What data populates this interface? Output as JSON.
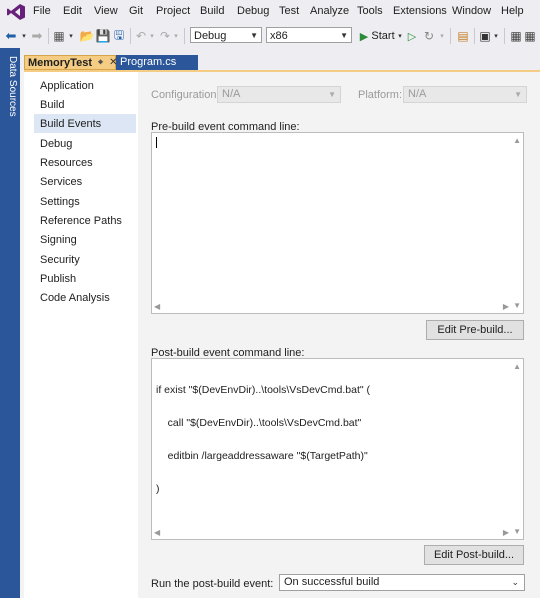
{
  "menu": {
    "items": [
      "File",
      "Edit",
      "View",
      "Git",
      "Project",
      "Build",
      "Debug",
      "Test",
      "Analyze",
      "Tools",
      "Extensions",
      "Window",
      "Help"
    ]
  },
  "toolbar": {
    "configuration": "Debug",
    "platform": "x86",
    "start_label": "Start"
  },
  "side_panel": {
    "label": "Data Sources"
  },
  "tabs": [
    {
      "label": "MemoryTest",
      "active": true
    },
    {
      "label": "Program.cs",
      "active": false
    }
  ],
  "nav": {
    "items": [
      "Application",
      "Build",
      "Build Events",
      "Debug",
      "Resources",
      "Services",
      "Settings",
      "Reference Paths",
      "Signing",
      "Security",
      "Publish",
      "Code Analysis"
    ],
    "selected": "Build Events"
  },
  "content": {
    "configuration_label": "Configuration:",
    "configuration_value": "N/A",
    "platform_label": "Platform:",
    "platform_value": "N/A",
    "prebuild_label": "Pre-build event command line:",
    "prebuild_value": "",
    "edit_prebuild_button": "Edit Pre-build...",
    "postbuild_label": "Post-build event command line:",
    "postbuild_lines": [
      "if exist \"$(DevEnvDir)..\\tools\\VsDevCmd.bat\" (",
      "    call \"$(DevEnvDir)..\\tools\\VsDevCmd.bat\"",
      "    editbin /largeaddressaware \"$(TargetPath)\"",
      ")"
    ],
    "edit_postbuild_button": "Edit Post-build...",
    "run_postbuild_label": "Run the post-build event:",
    "run_postbuild_value": "On successful build"
  },
  "colors": {
    "accent_tab": "#f5cc84",
    "side_rail": "#2b579a",
    "selection": "#dce6f4"
  }
}
